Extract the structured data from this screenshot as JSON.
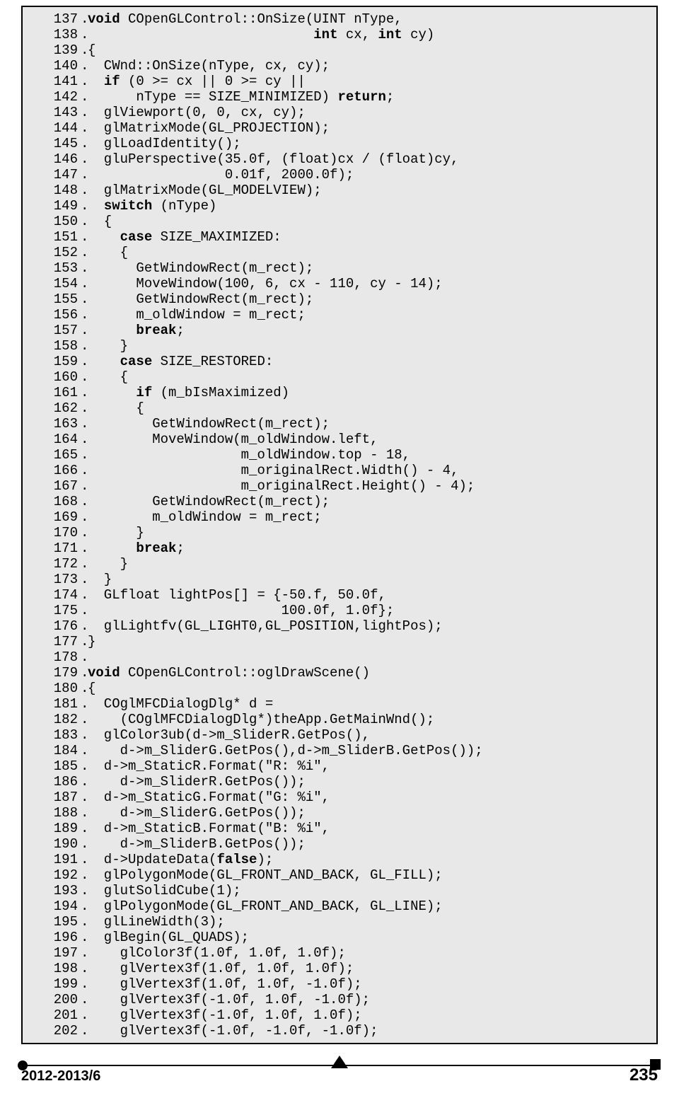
{
  "footer": {
    "left": "2012-2013/6",
    "page": "235"
  },
  "code": [
    {
      "n": "137",
      "segs": [
        {
          "t": "void ",
          "b": true
        },
        {
          "t": "COpenGLControl::OnSize(UINT nType,"
        }
      ]
    },
    {
      "n": "138",
      "segs": [
        {
          "t": "                            "
        },
        {
          "t": "int",
          "b": true
        },
        {
          "t": " cx, "
        },
        {
          "t": "int",
          "b": true
        },
        {
          "t": " cy)"
        }
      ]
    },
    {
      "n": "139",
      "segs": [
        {
          "t": "{"
        }
      ]
    },
    {
      "n": "140",
      "segs": [
        {
          "t": "  CWnd::OnSize(nType, cx, cy);"
        }
      ]
    },
    {
      "n": "141",
      "segs": [
        {
          "t": "  "
        },
        {
          "t": "if",
          "b": true
        },
        {
          "t": " (0 >= cx || 0 >= cy ||"
        }
      ]
    },
    {
      "n": "142",
      "segs": [
        {
          "t": "      nType == SIZE_MINIMIZED) "
        },
        {
          "t": "return",
          "b": true
        },
        {
          "t": ";"
        }
      ]
    },
    {
      "n": "143",
      "segs": [
        {
          "t": "  glViewport(0, 0, cx, cy);"
        }
      ]
    },
    {
      "n": "144",
      "segs": [
        {
          "t": "  glMatrixMode(GL_PROJECTION);"
        }
      ]
    },
    {
      "n": "145",
      "segs": [
        {
          "t": "  glLoadIdentity();"
        }
      ]
    },
    {
      "n": "146",
      "segs": [
        {
          "t": "  gluPerspective(35.0f, (float)cx / (float)cy,"
        }
      ]
    },
    {
      "n": "147",
      "segs": [
        {
          "t": "                 0.01f, 2000.0f);"
        }
      ]
    },
    {
      "n": "148",
      "segs": [
        {
          "t": "  glMatrixMode(GL_MODELVIEW);"
        }
      ]
    },
    {
      "n": "149",
      "segs": [
        {
          "t": "  "
        },
        {
          "t": "switch",
          "b": true
        },
        {
          "t": " (nType)"
        }
      ]
    },
    {
      "n": "150",
      "segs": [
        {
          "t": "  {"
        }
      ]
    },
    {
      "n": "151",
      "segs": [
        {
          "t": "    "
        },
        {
          "t": "case",
          "b": true
        },
        {
          "t": " SIZE_MAXIMIZED:"
        }
      ]
    },
    {
      "n": "152",
      "segs": [
        {
          "t": "    {"
        }
      ]
    },
    {
      "n": "153",
      "segs": [
        {
          "t": "      GetWindowRect(m_rect);"
        }
      ]
    },
    {
      "n": "154",
      "segs": [
        {
          "t": "      MoveWindow(100, 6, cx - 110, cy - 14);"
        }
      ]
    },
    {
      "n": "155",
      "segs": [
        {
          "t": "      GetWindowRect(m_rect);"
        }
      ]
    },
    {
      "n": "156",
      "segs": [
        {
          "t": "      m_oldWindow = m_rect;"
        }
      ]
    },
    {
      "n": "157",
      "segs": [
        {
          "t": "      "
        },
        {
          "t": "break",
          "b": true
        },
        {
          "t": ";"
        }
      ]
    },
    {
      "n": "158",
      "segs": [
        {
          "t": "    }"
        }
      ]
    },
    {
      "n": "159",
      "segs": [
        {
          "t": "    "
        },
        {
          "t": "case",
          "b": true
        },
        {
          "t": " SIZE_RESTORED:"
        }
      ]
    },
    {
      "n": "160",
      "segs": [
        {
          "t": "    {"
        }
      ]
    },
    {
      "n": "161",
      "segs": [
        {
          "t": "      "
        },
        {
          "t": "if",
          "b": true
        },
        {
          "t": " (m_bIsMaximized)"
        }
      ]
    },
    {
      "n": "162",
      "segs": [
        {
          "t": "      {"
        }
      ]
    },
    {
      "n": "163",
      "segs": [
        {
          "t": "        GetWindowRect(m_rect);"
        }
      ]
    },
    {
      "n": "164",
      "segs": [
        {
          "t": "        MoveWindow(m_oldWindow.left,"
        }
      ]
    },
    {
      "n": "165",
      "segs": [
        {
          "t": "                   m_oldWindow.top - 18,"
        }
      ]
    },
    {
      "n": "166",
      "segs": [
        {
          "t": "                   m_originalRect.Width() - 4,"
        }
      ]
    },
    {
      "n": "167",
      "segs": [
        {
          "t": "                   m_originalRect.Height() - 4);"
        }
      ]
    },
    {
      "n": "168",
      "segs": [
        {
          "t": "        GetWindowRect(m_rect);"
        }
      ]
    },
    {
      "n": "169",
      "segs": [
        {
          "t": "        m_oldWindow = m_rect;"
        }
      ]
    },
    {
      "n": "170",
      "segs": [
        {
          "t": "      }"
        }
      ]
    },
    {
      "n": "171",
      "segs": [
        {
          "t": "      "
        },
        {
          "t": "break",
          "b": true
        },
        {
          "t": ";"
        }
      ]
    },
    {
      "n": "172",
      "segs": [
        {
          "t": "    }"
        }
      ]
    },
    {
      "n": "173",
      "segs": [
        {
          "t": "  }"
        }
      ]
    },
    {
      "n": "174",
      "segs": [
        {
          "t": "  GLfloat lightPos[] = {-50.f, 50.0f,"
        }
      ]
    },
    {
      "n": "175",
      "segs": [
        {
          "t": "                        100.0f, 1.0f};"
        }
      ]
    },
    {
      "n": "176",
      "segs": [
        {
          "t": "  glLightfv(GL_LIGHT0,GL_POSITION,lightPos);"
        }
      ]
    },
    {
      "n": "177",
      "segs": [
        {
          "t": "}"
        }
      ]
    },
    {
      "n": "178",
      "segs": [
        {
          "t": ""
        }
      ]
    },
    {
      "n": "179",
      "segs": [
        {
          "t": "void",
          "b": true
        },
        {
          "t": " COpenGLControl::oglDrawScene()"
        }
      ]
    },
    {
      "n": "180",
      "segs": [
        {
          "t": "{"
        }
      ]
    },
    {
      "n": "181",
      "segs": [
        {
          "t": "  COglMFCDialogDlg* d = "
        }
      ]
    },
    {
      "n": "182",
      "segs": [
        {
          "t": "    (COglMFCDialogDlg*)theApp.GetMainWnd();"
        }
      ]
    },
    {
      "n": "183",
      "segs": [
        {
          "t": "  glColor3ub(d->m_SliderR.GetPos(),"
        }
      ]
    },
    {
      "n": "184",
      "segs": [
        {
          "t": "    d->m_SliderG.GetPos(),d->m_SliderB.GetPos());"
        }
      ]
    },
    {
      "n": "185",
      "segs": [
        {
          "t": "  d->m_StaticR.Format(\"R: %i\","
        }
      ]
    },
    {
      "n": "186",
      "segs": [
        {
          "t": "    d->m_SliderR.GetPos());"
        }
      ]
    },
    {
      "n": "187",
      "segs": [
        {
          "t": "  d->m_StaticG.Format(\"G: %i\","
        }
      ]
    },
    {
      "n": "188",
      "segs": [
        {
          "t": "    d->m_SliderG.GetPos());"
        }
      ]
    },
    {
      "n": "189",
      "segs": [
        {
          "t": "  d->m_StaticB.Format(\"B: %i\","
        }
      ]
    },
    {
      "n": "190",
      "segs": [
        {
          "t": "    d->m_SliderB.GetPos());"
        }
      ]
    },
    {
      "n": "191",
      "segs": [
        {
          "t": "  d->UpdateData("
        },
        {
          "t": "false",
          "b": true
        },
        {
          "t": ");"
        }
      ]
    },
    {
      "n": "192",
      "segs": [
        {
          "t": "  glPolygonMode(GL_FRONT_AND_BACK, GL_FILL);"
        }
      ]
    },
    {
      "n": "193",
      "segs": [
        {
          "t": "  glutSolidCube(1);"
        }
      ]
    },
    {
      "n": "194",
      "segs": [
        {
          "t": "  glPolygonMode(GL_FRONT_AND_BACK, GL_LINE);"
        }
      ]
    },
    {
      "n": "195",
      "segs": [
        {
          "t": "  glLineWidth(3);"
        }
      ]
    },
    {
      "n": "196",
      "segs": [
        {
          "t": "  glBegin(GL_QUADS);"
        }
      ]
    },
    {
      "n": "197",
      "segs": [
        {
          "t": "    glColor3f(1.0f, 1.0f, 1.0f);"
        }
      ]
    },
    {
      "n": "198",
      "segs": [
        {
          "t": "    glVertex3f(1.0f, 1.0f, 1.0f);"
        }
      ]
    },
    {
      "n": "199",
      "segs": [
        {
          "t": "    glVertex3f(1.0f, 1.0f, -1.0f);"
        }
      ]
    },
    {
      "n": "200",
      "segs": [
        {
          "t": "    glVertex3f(-1.0f, 1.0f, -1.0f);"
        }
      ]
    },
    {
      "n": "201",
      "segs": [
        {
          "t": "    glVertex3f(-1.0f, 1.0f, 1.0f);"
        }
      ]
    },
    {
      "n": "202",
      "segs": [
        {
          "t": "    glVertex3f(-1.0f, -1.0f, -1.0f);"
        }
      ]
    }
  ]
}
